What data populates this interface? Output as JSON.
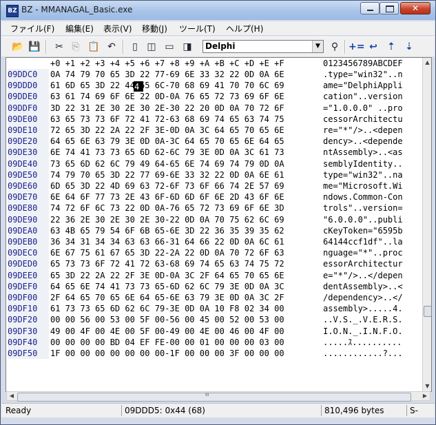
{
  "window": {
    "app_icon": "BZ",
    "title": "BZ - MMANAGAL_Basic.exe",
    "minimize_icon": "minimize-icon",
    "maximize_icon": "maximize-icon",
    "close_glyph": "✕"
  },
  "menu": [
    {
      "label": "ファイル(F)"
    },
    {
      "label": "編集(E)"
    },
    {
      "label": "表示(V)"
    },
    {
      "label": "移動(J)"
    },
    {
      "label": "ツール(T)"
    },
    {
      "label": "ヘルプ(H)"
    }
  ],
  "toolbar": {
    "open_glyph": "📂",
    "save_glyph": "💾",
    "cut_glyph": "✂",
    "copy_glyph": "⎘",
    "paste_glyph": "📋",
    "undo_glyph": "↶",
    "view1_glyph": "▯",
    "view2_glyph": "◫",
    "view3_glyph": "▭",
    "view4_glyph": "◨",
    "charset_value": "Delphi",
    "combo_arrow": "▼",
    "find_glyph": "⚲",
    "compare_glyph": "+=",
    "jump_glyph": "↩",
    "up_glyph": "⇡",
    "down_glyph": "⇣"
  },
  "hex": {
    "column_header": "+0 +1 +2 +3 +4 +5 +6 +7 +8 +9 +A +B +C +D +E +F",
    "ascii_header": "0123456789ABCDEF",
    "addresses": "09DDC0\n09DDD0\n09DDE0\n09DDF0\n09DE00\n09DE10\n09DE20\n09DE30\n09DE40\n09DE50\n09DE60\n09DE70\n09DE80\n09DE90\n09DEA0\n09DEB0\n09DEC0\n09DED0\n09DEE0\n09DEF0\n09DF00\n09DF10\n09DF20\n09DF30\n09DF40\n09DF50",
    "bytes": "0A 74 79 70 65 3D 22 77-69 6E 33 32 22 0D 0A 6E\n61 6D 65 3D 22 44 65 6C-70 68 69 41 70 70 6C 69\n63 61 74 69 6F 6E 22 0D-0A 76 65 72 73 69 6F 6E\n3D 22 31 2E 30 2E 30 2E-30 22 20 0D 0A 70 72 6F\n63 65 73 73 6F 72 41 72-63 68 69 74 65 63 74 75\n72 65 3D 22 2A 22 2F 3E-0D 0A 3C 64 65 70 65 6E\n64 65 6E 63 79 3E 0D 0A-3C 64 65 70 65 6E 64 65\n6E 74 41 73 73 65 6D 62-6C 79 3E 0D 0A 3C 61 73\n73 65 6D 62 6C 79 49 64-65 6E 74 69 74 79 0D 0A\n74 79 70 65 3D 22 77 69-6E 33 32 22 0D 0A 6E 61\n6D 65 3D 22 4D 69 63 72-6F 73 6F 66 74 2E 57 69\n6E 64 6F 77 73 2E 43 6F-6D 6D 6F 6E 2D 43 6F 6E\n74 72 6F 6C 73 22 0D 0A-76 65 72 73 69 6F 6E 3D\n22 36 2E 30 2E 30 2E 30-22 0D 0A 70 75 62 6C 69\n63 4B 65 79 54 6F 6B 65-6E 3D 22 36 35 39 35 62\n36 34 31 34 34 63 63 66-31 64 66 22 0D 0A 6C 61\n6E 67 75 61 67 65 3D 22-2A 22 0D 0A 70 72 6F 63\n65 73 73 6F 72 41 72 63-68 69 74 65 63 74 75 72\n65 3D 22 2A 22 2F 3E 0D-0A 3C 2F 64 65 70 65 6E\n64 65 6E 74 41 73 73 65-6D 62 6C 79 3E 0D 0A 3C\n2F 64 65 70 65 6E 64 65-6E 63 79 3E 0D 0A 3C 2F\n61 73 73 65 6D 62 6C 79-3E 0D 0A 10 F8 02 34 00\n00 00 56 00 53 00 5F 00-56 00 45 00 52 00 53 00\n49 00 4F 00 4E 00 5F 00-49 00 4E 00 46 00 4F 00\n00 00 00 00 BD 04 EF FE-00 00 01 00 00 00 03 00\n1F 00 00 00 00 00 00 00-1F 00 00 00 3F 00 00 00",
    "ascii": ".type=\"win32\"..n\name=\"DelphiAppli\ncation\"..version\n=\"1.0.0.0\" ..pro\ncessorArchitectu\nre=\"*\"/>..<depen\ndency>..<depende\nntAssembly>..<as\nsemblyIdentity..\ntype=\"win32\"..na\nme=\"Microsoft.Wi\nndows.Common-Con\ntrols\"..version=\n\"6.0.0.0\"..publi\ncKeyToken=\"6595b\n64144ccf1df\"..la\nnguage=\"*\"..proc\nessorArchitectur\ne=\"*\"/>..</depen\ndentAssembly>..<\n/dependency>..</\nassembly>.....4.\n..V.S._.V.E.R.S.\nI.O.N._.I.N.F.O.\n.....ｽ..........\n............?...",
    "cursor_char": "4"
  },
  "scrollbar": {
    "up_arrow": "▲",
    "down_arrow": "▼",
    "left_arrow": "◀",
    "right_arrow": "▶",
    "grip": "III"
  },
  "status": {
    "state": "Ready",
    "position": "09DDD5: 0x44 (68)",
    "size": "810,496 bytes",
    "mode": "S-"
  }
}
